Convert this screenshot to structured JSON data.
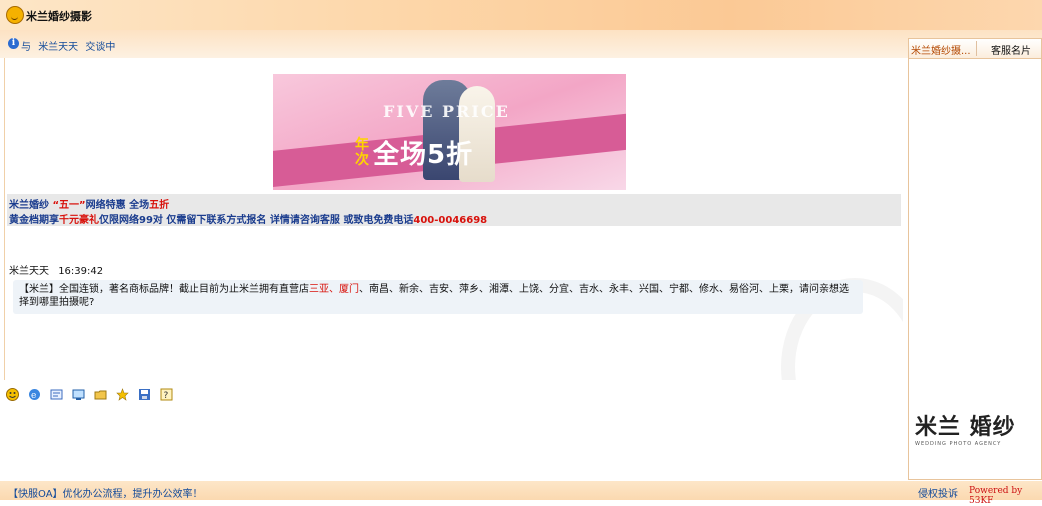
{
  "window": {
    "title": "米兰婚纱摄影"
  },
  "subbar": {
    "talk_prefix": "与",
    "agent": "米兰天天",
    "talk_suffix": "交谈中"
  },
  "banner": {
    "headline": "全场5折",
    "year_text": "年\n次",
    "english": "FIVE PRICE"
  },
  "announce": {
    "line1_a": "米兰婚纱",
    "line1_b": "“五一”",
    "line1_c": "网络特惠 全场",
    "line1_d": "五折",
    "line2_a": "黄金档期享",
    "line2_b": "千元豪礼",
    "line2_c": "仅限网络99对 仅需留下联系方式报名 详情请咨询客服 或致电免费电话",
    "line2_d": "400-0046698"
  },
  "message": {
    "sender": "米兰天天",
    "time": "16:39:42",
    "text_a": "【米兰】全国连锁，著名商标品牌！截止目前为止米兰拥有直营店",
    "text_b": "三亚、厦门",
    "text_c": "、南昌、新余、吉安、萍乡、湘潭、上饶、分宜、吉水、永丰、兴国、宁都、修水、易俗河、上栗，请问亲想选择到哪里拍摄呢?"
  },
  "toolbar": {
    "icons": [
      "smiley-icon",
      "browser-icon",
      "note-icon",
      "screenshot-icon",
      "folder-icon",
      "star-icon",
      "save-icon",
      "help-icon"
    ]
  },
  "footer": {
    "oa_text": "【快服OA】优化办公流程，提升办公效率！",
    "complaint": "侵权投诉",
    "powered": "Powered by 53KF"
  },
  "right_panel": {
    "tab1": "米兰婚纱摄...",
    "tab2": "客服名片",
    "brand_cn": "米兰 婚纱",
    "brand_en": "WEDDING PHOTO AGENCY"
  },
  "colors": {
    "accent": "#124a9a",
    "highlight": "#d8100a",
    "titlebar": "#fdd6a8"
  }
}
